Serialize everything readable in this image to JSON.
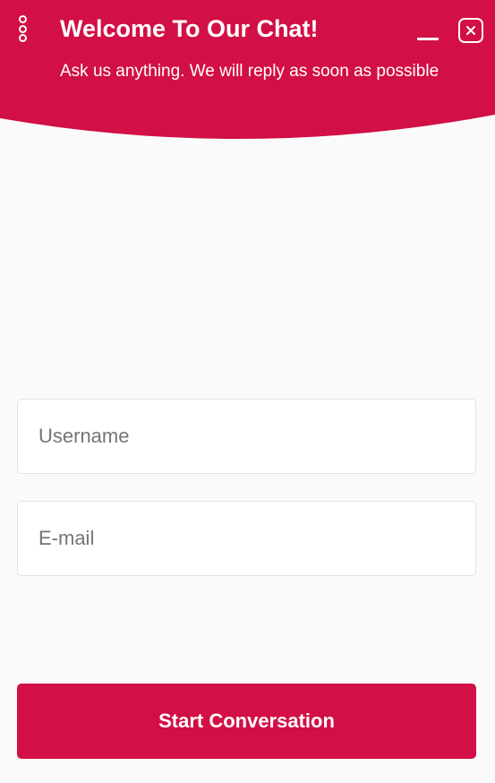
{
  "header": {
    "title": "Welcome To Our Chat!",
    "subtitle": "Ask us anything. We will reply as soon as possible",
    "background_color": "#d20f46",
    "menu_icon": "vertical-dots-icon",
    "minimize_icon": "minimize-icon",
    "close_icon": "close-icon"
  },
  "form": {
    "username": {
      "placeholder": "Username",
      "value": ""
    },
    "email": {
      "placeholder": "E-mail",
      "value": ""
    },
    "submit_label": "Start Conversation",
    "accent_color": "#d20f46"
  }
}
